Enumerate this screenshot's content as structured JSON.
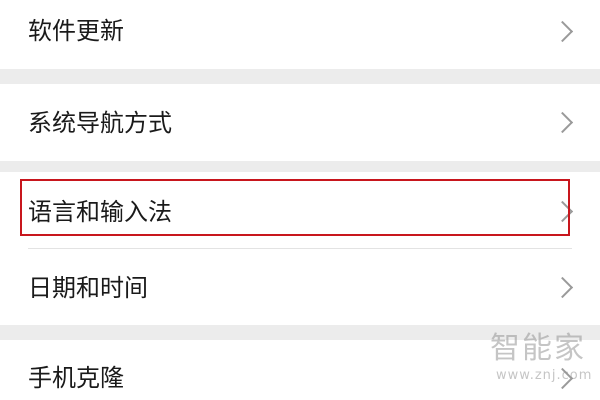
{
  "settings_list": {
    "items": [
      {
        "label": "软件更新"
      },
      {
        "label": "系统导航方式"
      },
      {
        "label": "语言和输入法",
        "highlighted": true
      },
      {
        "label": "日期和时间"
      },
      {
        "label": "手机克隆"
      }
    ],
    "chevron_icon": "chevron-right-icon"
  },
  "highlight": {
    "color": "#c8161d"
  },
  "watermark": {
    "name": "智能家",
    "url": "www.znj.com"
  },
  "colors": {
    "background": "#ececec",
    "card": "#ffffff",
    "text": "#1a1a1a",
    "chevron": "#9a9a9a"
  }
}
